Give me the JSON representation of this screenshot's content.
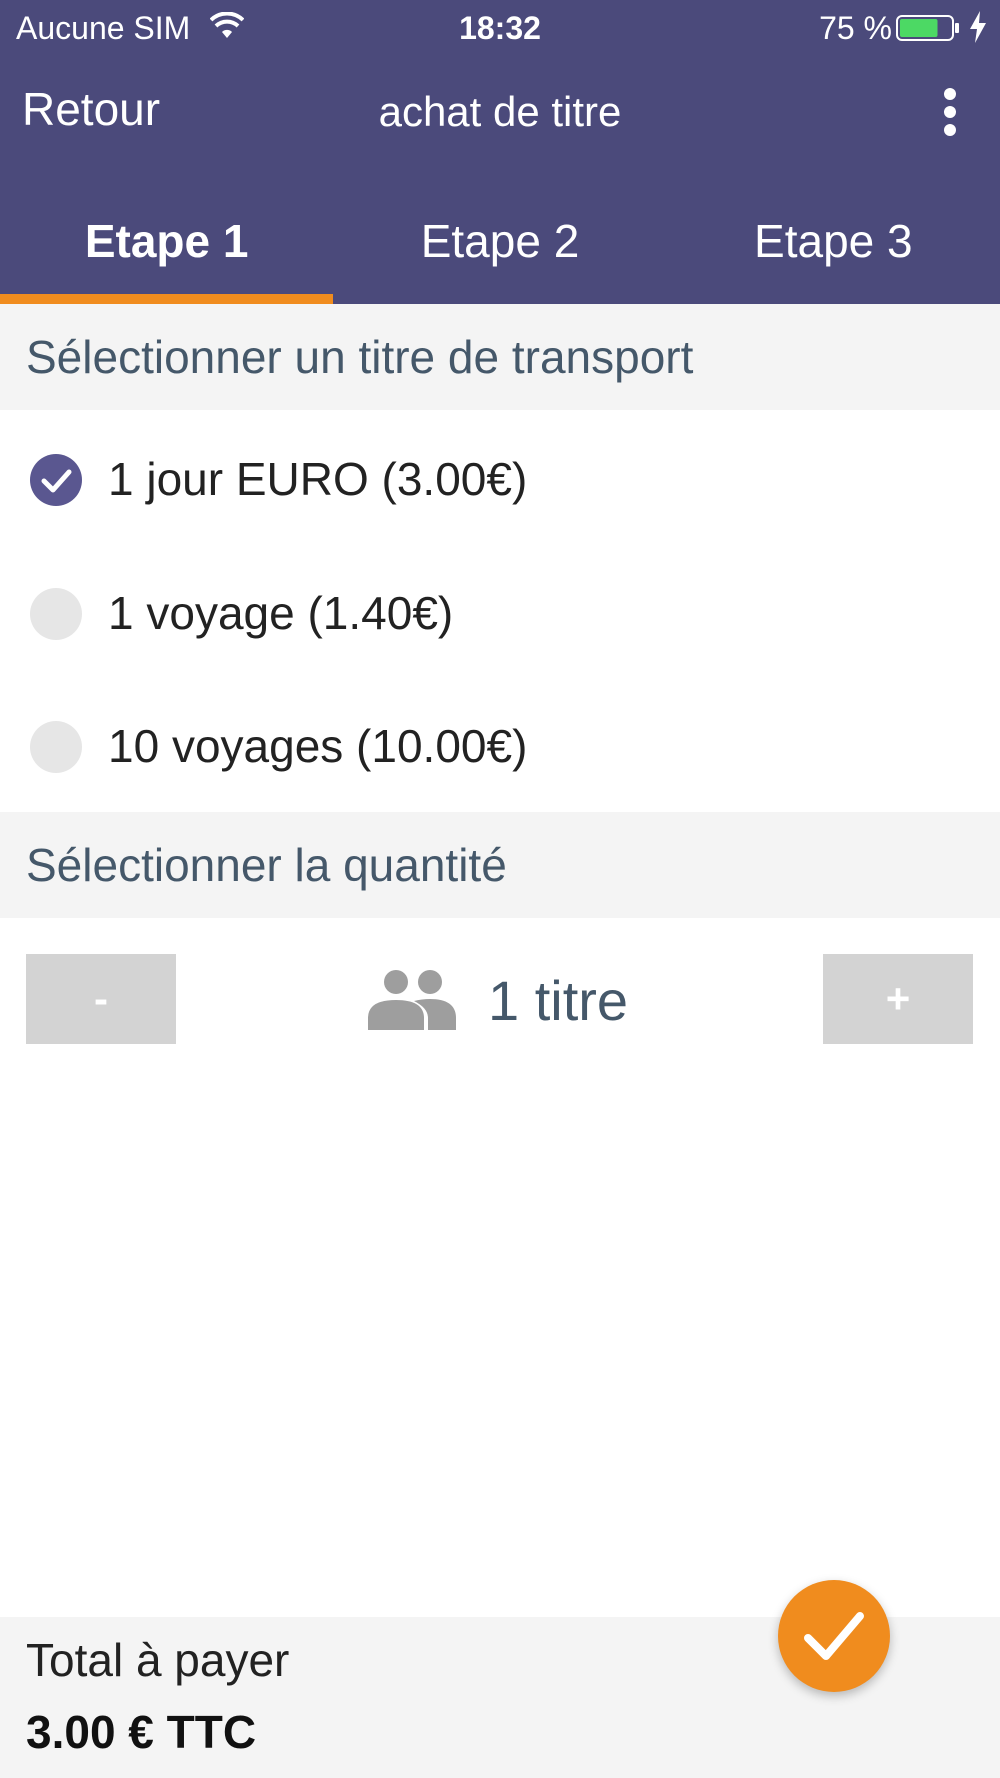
{
  "status_bar": {
    "carrier": "Aucune SIM",
    "time": "18:32",
    "battery_percent": "75 %",
    "battery_level": 0.75,
    "icons": [
      "wifi-icon",
      "battery-icon",
      "charging-bolt-icon"
    ]
  },
  "nav": {
    "back_label": "Retour",
    "title": "achat de titre",
    "menu_icon": "more-vertical-icon"
  },
  "tabs": [
    {
      "label": "Etape 1",
      "active": true
    },
    {
      "label": "Etape 2",
      "active": false
    },
    {
      "label": "Etape 3",
      "active": false
    }
  ],
  "ticket_section": {
    "title": "Sélectionner un titre de transport",
    "options": [
      {
        "label": "1 jour EURO (3.00€)",
        "selected": true
      },
      {
        "label": "1 voyage (1.40€)",
        "selected": false
      },
      {
        "label": "10 voyages (10.00€)",
        "selected": false
      }
    ]
  },
  "quantity_section": {
    "title": "Sélectionner la quantité",
    "minus_label": "-",
    "plus_label": "+",
    "quantity_text": "1 titre",
    "icon": "people-icon"
  },
  "footer": {
    "total_label": "Total à payer",
    "total_value": "3.00 € TTC",
    "confirm_icon": "checkmark-icon"
  },
  "colors": {
    "header_bg": "#4b4a7b",
    "accent": "#f08c1e",
    "radio_checked": "#5a5790",
    "section_bg": "#f4f4f4",
    "section_text": "#45586a"
  }
}
